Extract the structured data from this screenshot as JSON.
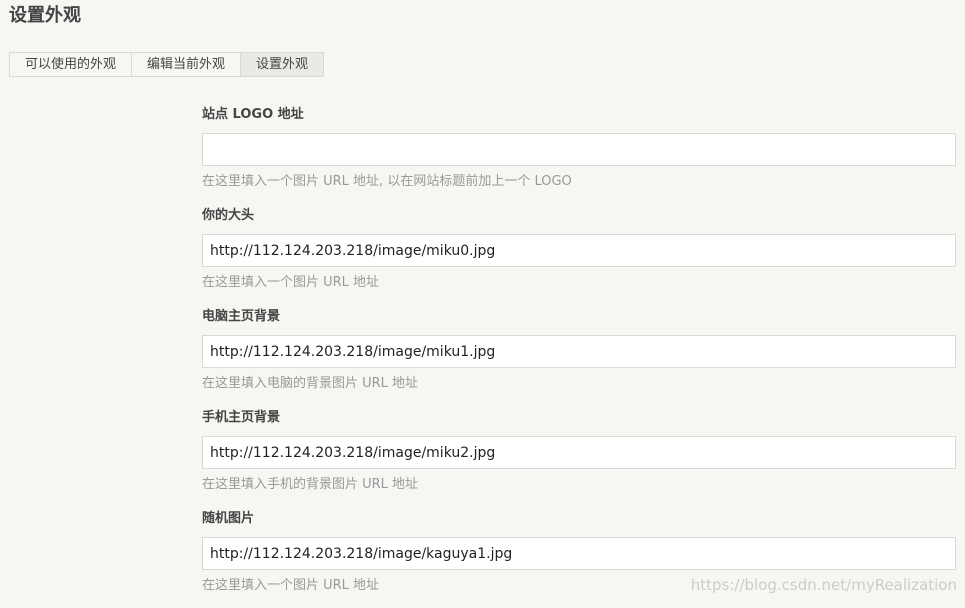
{
  "page": {
    "title": "设置外观"
  },
  "tabs": [
    {
      "label": "可以使用的外观",
      "active": false
    },
    {
      "label": "编辑当前外观",
      "active": false
    },
    {
      "label": "设置外观",
      "active": true
    }
  ],
  "fields": [
    {
      "label": "站点 LOGO 地址",
      "value": "",
      "description": "在这里填入一个图片 URL 地址, 以在网站标题前加上一个 LOGO"
    },
    {
      "label": "你的大头",
      "value": "http://112.124.203.218/image/miku0.jpg",
      "description": "在这里填入一个图片 URL 地址"
    },
    {
      "label": "电脑主页背景",
      "value": "http://112.124.203.218/image/miku1.jpg",
      "description": "在这里填入电脑的背景图片 URL 地址"
    },
    {
      "label": "手机主页背景",
      "value": "http://112.124.203.218/image/miku2.jpg",
      "description": "在这里填入手机的背景图片 URL 地址"
    },
    {
      "label": "随机图片",
      "value": "http://112.124.203.218/image/kaguya1.jpg",
      "description": "在这里填入一个图片 URL 地址"
    }
  ],
  "watermark": "https://blog.csdn.net/myRealization"
}
